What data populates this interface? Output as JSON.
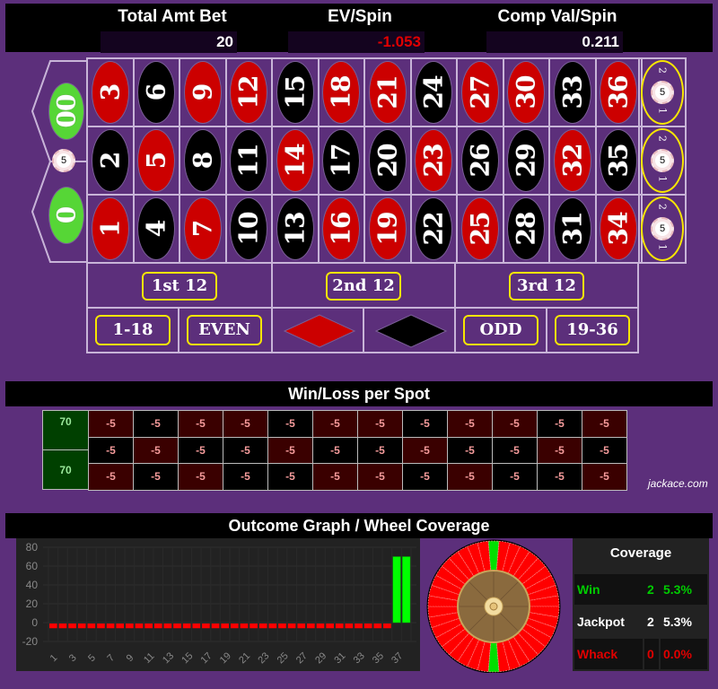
{
  "header": {
    "total_bet_label": "Total Amt Bet",
    "total_bet_value": "20",
    "ev_label": "EV/Spin",
    "ev_value": "-1.053",
    "comp_label": "Comp Val/Spin",
    "comp_value": "0.211"
  },
  "colors": {
    "felt": "#5c2f7b",
    "red": "#cc0000",
    "black": "#000000",
    "green": "#56d636",
    "gold": "#f7e600",
    "negative": "#e00000"
  },
  "table": {
    "zeros": [
      {
        "label": "00",
        "color": "green"
      },
      {
        "label": "0",
        "color": "green"
      }
    ],
    "rows": [
      [
        {
          "n": "3",
          "c": "red"
        },
        {
          "n": "6",
          "c": "black"
        },
        {
          "n": "9",
          "c": "red"
        },
        {
          "n": "12",
          "c": "red"
        },
        {
          "n": "15",
          "c": "black"
        },
        {
          "n": "18",
          "c": "red"
        },
        {
          "n": "21",
          "c": "red"
        },
        {
          "n": "24",
          "c": "black"
        },
        {
          "n": "27",
          "c": "red"
        },
        {
          "n": "30",
          "c": "red"
        },
        {
          "n": "33",
          "c": "black"
        },
        {
          "n": "36",
          "c": "red"
        }
      ],
      [
        {
          "n": "2",
          "c": "black"
        },
        {
          "n": "5",
          "c": "red"
        },
        {
          "n": "8",
          "c": "black"
        },
        {
          "n": "11",
          "c": "black"
        },
        {
          "n": "14",
          "c": "red"
        },
        {
          "n": "17",
          "c": "black"
        },
        {
          "n": "20",
          "c": "black"
        },
        {
          "n": "23",
          "c": "red"
        },
        {
          "n": "26",
          "c": "black"
        },
        {
          "n": "29",
          "c": "black"
        },
        {
          "n": "32",
          "c": "red"
        },
        {
          "n": "35",
          "c": "black"
        }
      ],
      [
        {
          "n": "1",
          "c": "red"
        },
        {
          "n": "4",
          "c": "black"
        },
        {
          "n": "7",
          "c": "red"
        },
        {
          "n": "10",
          "c": "black"
        },
        {
          "n": "13",
          "c": "black"
        },
        {
          "n": "16",
          "c": "red"
        },
        {
          "n": "19",
          "c": "red"
        },
        {
          "n": "22",
          "c": "black"
        },
        {
          "n": "25",
          "c": "red"
        },
        {
          "n": "28",
          "c": "black"
        },
        {
          "n": "31",
          "c": "black"
        },
        {
          "n": "34",
          "c": "red"
        }
      ]
    ],
    "column_bet_label": "2 to 1",
    "chips": {
      "zero_split": "5",
      "column_top": "5",
      "column_mid": "5",
      "column_bot": "5"
    },
    "dozens": [
      "1st 12",
      "2nd 12",
      "3rd 12"
    ],
    "outside": {
      "low": "1-18",
      "even": "EVEN",
      "red": "red-diamond",
      "black": "black-diamond",
      "odd": "ODD",
      "high": "19-36"
    }
  },
  "winloss": {
    "title": "Win/Loss per Spot",
    "zeros": [
      "70",
      "70"
    ],
    "rows": [
      [
        "-5",
        "-5",
        "-5",
        "-5",
        "-5",
        "-5",
        "-5",
        "-5",
        "-5",
        "-5",
        "-5",
        "-5"
      ],
      [
        "-5",
        "-5",
        "-5",
        "-5",
        "-5",
        "-5",
        "-5",
        "-5",
        "-5",
        "-5",
        "-5",
        "-5"
      ],
      [
        "-5",
        "-5",
        "-5",
        "-5",
        "-5",
        "-5",
        "-5",
        "-5",
        "-5",
        "-5",
        "-5",
        "-5"
      ]
    ],
    "credit": "jackace.com"
  },
  "outcome": {
    "title": "Outcome Graph / Wheel Coverage"
  },
  "chart_data": {
    "type": "bar",
    "title": "",
    "xlabel": "",
    "ylabel": "",
    "categories": [
      "1",
      "2",
      "3",
      "4",
      "5",
      "6",
      "7",
      "8",
      "9",
      "10",
      "11",
      "12",
      "13",
      "14",
      "15",
      "16",
      "17",
      "18",
      "19",
      "20",
      "21",
      "22",
      "23",
      "24",
      "25",
      "26",
      "27",
      "28",
      "29",
      "30",
      "31",
      "32",
      "33",
      "34",
      "35",
      "36",
      "37",
      "38"
    ],
    "x_tick_labels": [
      "1",
      "3",
      "5",
      "7",
      "9",
      "11",
      "13",
      "15",
      "17",
      "19",
      "21",
      "23",
      "25",
      "27",
      "29",
      "31",
      "33",
      "35",
      "37"
    ],
    "values": [
      -5,
      -5,
      -5,
      -5,
      -5,
      -5,
      -5,
      -5,
      -5,
      -5,
      -5,
      -5,
      -5,
      -5,
      -5,
      -5,
      -5,
      -5,
      -5,
      -5,
      -5,
      -5,
      -5,
      -5,
      -5,
      -5,
      -5,
      -5,
      -5,
      -5,
      -5,
      -5,
      -5,
      -5,
      -5,
      -5,
      70,
      70
    ],
    "ylim": [
      -20,
      80
    ],
    "y_ticks": [
      80,
      60,
      40,
      20,
      0,
      -20
    ],
    "grid": true,
    "positive_color": "#00ff00",
    "negative_color": "#ff0000"
  },
  "wheel": {
    "pockets": 38,
    "win_pockets": 2,
    "win_color": "#00e000",
    "lose_color": "#ff0000"
  },
  "coverage": {
    "title": "Coverage",
    "rows": [
      {
        "label": "Win",
        "count": "2",
        "pct": "5.3%",
        "color": "#00cc00"
      },
      {
        "label": "Jackpot",
        "count": "2",
        "pct": "5.3%",
        "color": "#ffffff"
      },
      {
        "label": "Whack",
        "count": "0",
        "pct": "0.0%",
        "color": "#e00000"
      }
    ]
  }
}
